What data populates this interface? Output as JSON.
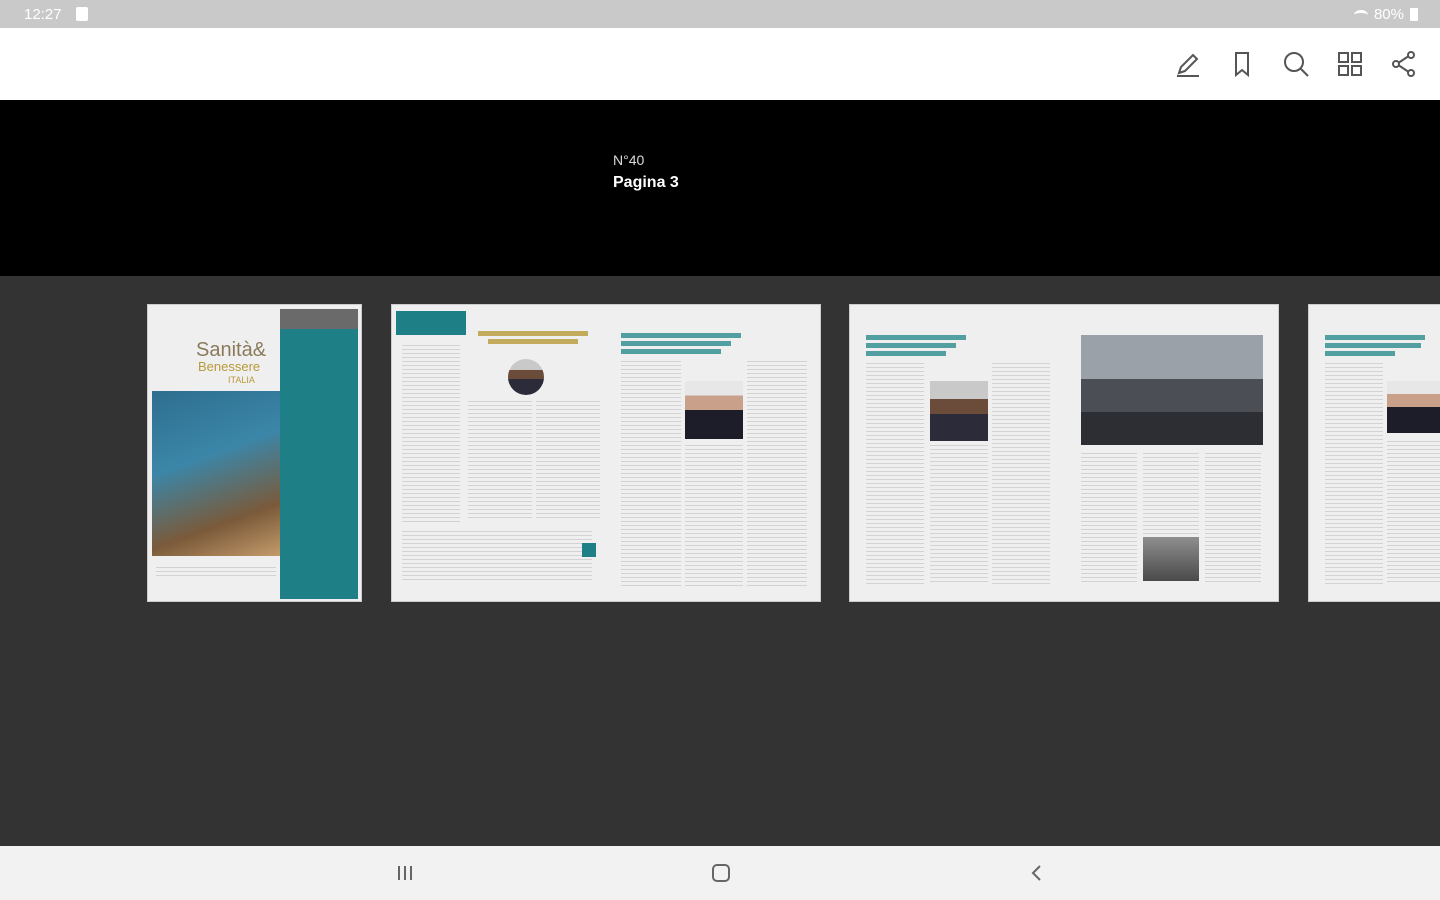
{
  "status_bar": {
    "time": "12:27",
    "battery": "80%"
  },
  "toolbar": {
    "icons": [
      "pencil-icon",
      "bookmark-icon",
      "search-icon",
      "grid-icon",
      "share-icon"
    ]
  },
  "header": {
    "issue": "N°40",
    "page_label": "Pagina 3"
  },
  "cover": {
    "brand_line1": "Sanità&",
    "brand_line2": "Benessere",
    "brand_line3": "ITALIA"
  },
  "colors": {
    "accent_teal": "#1f7f86",
    "gold": "#b89a3a",
    "header_bg": "#000000",
    "strip_bg": "#333333"
  }
}
